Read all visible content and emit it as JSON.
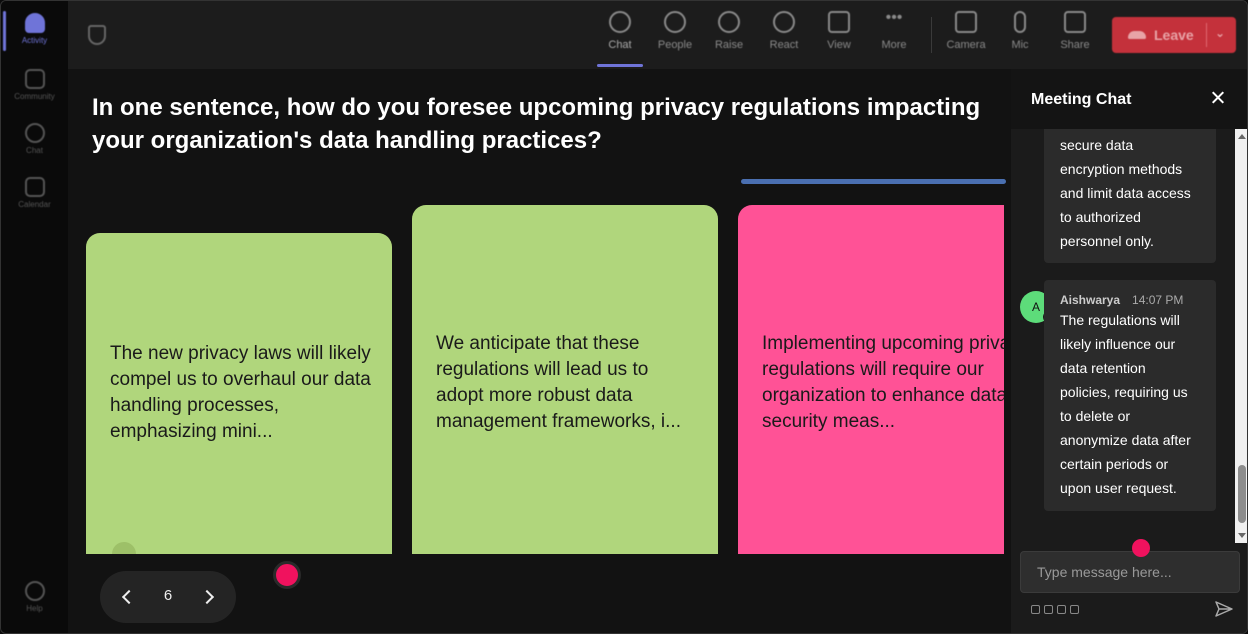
{
  "rail": {
    "items": [
      {
        "label": "Activity",
        "icon": "bell-icon",
        "active": true
      },
      {
        "label": "Community",
        "icon": "community-icon"
      },
      {
        "label": "Chat",
        "icon": "chat-icon"
      },
      {
        "label": "Calendar",
        "icon": "calendar-icon"
      }
    ],
    "help": {
      "label": "Help",
      "icon": "help-icon"
    }
  },
  "toolbar": {
    "items": [
      {
        "label": "Chat",
        "icon": "chat-icon",
        "active": true
      },
      {
        "label": "People",
        "icon": "people-icon"
      },
      {
        "label": "Raise",
        "icon": "raise-hand-icon"
      },
      {
        "label": "React",
        "icon": "smiley-icon"
      },
      {
        "label": "View",
        "icon": "grid-icon"
      },
      {
        "label": "More",
        "icon": "more-icon"
      },
      {
        "label": "Camera",
        "icon": "camera-off-icon"
      },
      {
        "label": "Mic",
        "icon": "mic-icon"
      },
      {
        "label": "Share",
        "icon": "share-icon"
      }
    ],
    "leave": {
      "label": "Leave",
      "color": "#c4313b"
    }
  },
  "main": {
    "question": "In one sentence, how do you foresee upcoming privacy regulations impacting your organization's data handling practices?",
    "cards": [
      {
        "text": "The new privacy laws will likely compel us to overhaul our data handling processes, emphasizing mini...",
        "color": "#b0d67c"
      },
      {
        "text": "We anticipate that these regulations will lead us to adopt more robust data management frameworks, i...",
        "color": "#b0d67c"
      },
      {
        "text": "Implementing upcoming privacy regulations will require our organization to enhance data security meas...",
        "color": "#ff5296"
      }
    ],
    "pager": {
      "page": "6"
    }
  },
  "chat": {
    "title": "Meeting Chat",
    "messages": [
      {
        "text": "secure data encryption methods and limit data access to authorized personnel only."
      },
      {
        "author": "Aishwarya",
        "avatar": "A",
        "time": "14:07 PM",
        "text": "The regulations will likely influence our data retention policies, requiring us to delete or anonymize data after certain periods or upon user request."
      }
    ],
    "input_placeholder": "Type message here..."
  },
  "colors": {
    "accent": "#6f74d8",
    "cursor": "#f0125e",
    "avatar": "#5ddc7a"
  }
}
